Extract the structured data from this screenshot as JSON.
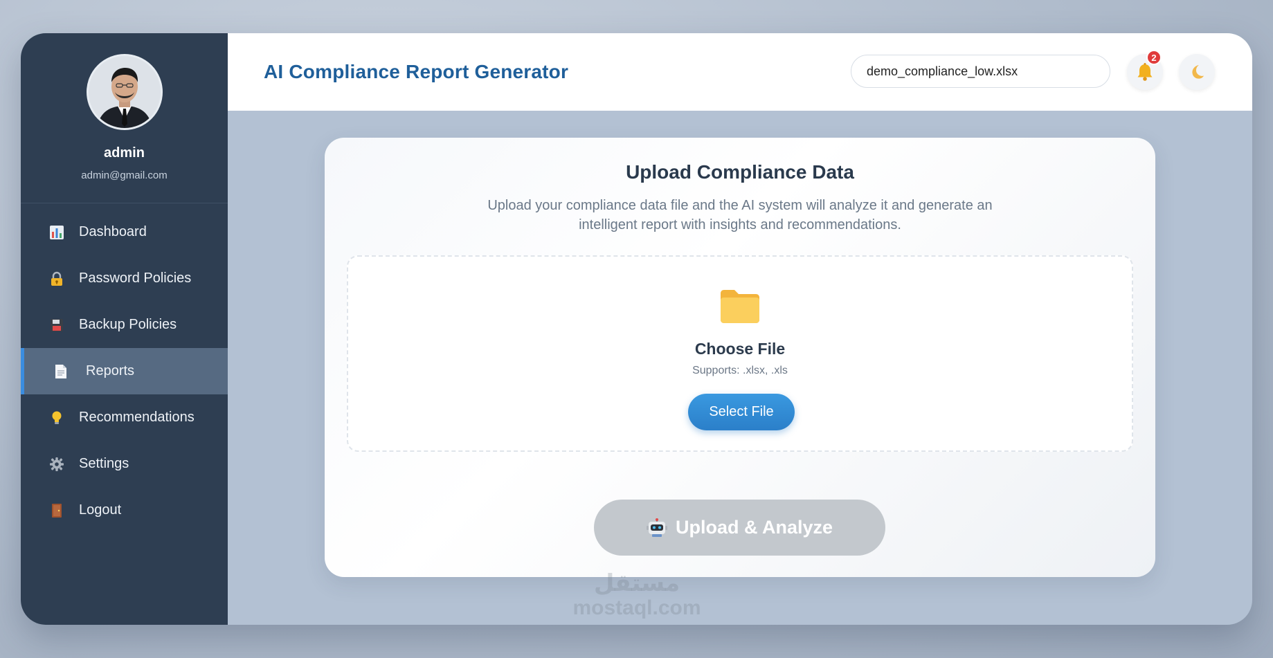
{
  "user": {
    "name": "admin",
    "email": "admin@gmail.com"
  },
  "sidebar": {
    "items": [
      {
        "label": "Dashboard",
        "icon": "bar-chart-icon",
        "active": false
      },
      {
        "label": "Password Policies",
        "icon": "lock-icon",
        "active": false
      },
      {
        "label": "Backup Policies",
        "icon": "floppy-disk-icon",
        "active": false
      },
      {
        "label": "Reports",
        "icon": "document-icon",
        "active": true
      },
      {
        "label": "Recommendations",
        "icon": "lightbulb-icon",
        "active": false
      },
      {
        "label": "Settings",
        "icon": "gear-icon",
        "active": false
      },
      {
        "label": "Logout",
        "icon": "door-icon",
        "active": false
      }
    ]
  },
  "header": {
    "title": "AI Compliance Report Generator",
    "search_value": "demo_compliance_low.xlsx",
    "notification_count": "2"
  },
  "upload": {
    "title": "Upload Compliance Data",
    "description": "Upload your compliance data file and the AI system will analyze it and generate an intelligent report with insights and recommendations.",
    "choose_label": "Choose File",
    "supports": "Supports: .xlsx, .xls",
    "select_button": "Select File",
    "submit_button": "Upload & Analyze"
  },
  "watermark": {
    "line1": "مستقل",
    "line2": "mostaql.com"
  },
  "colors": {
    "sidebar_bg": "#2e3e52",
    "accent": "#2b7fc9",
    "title": "#1f5f9a",
    "badge": "#e03b3b"
  }
}
